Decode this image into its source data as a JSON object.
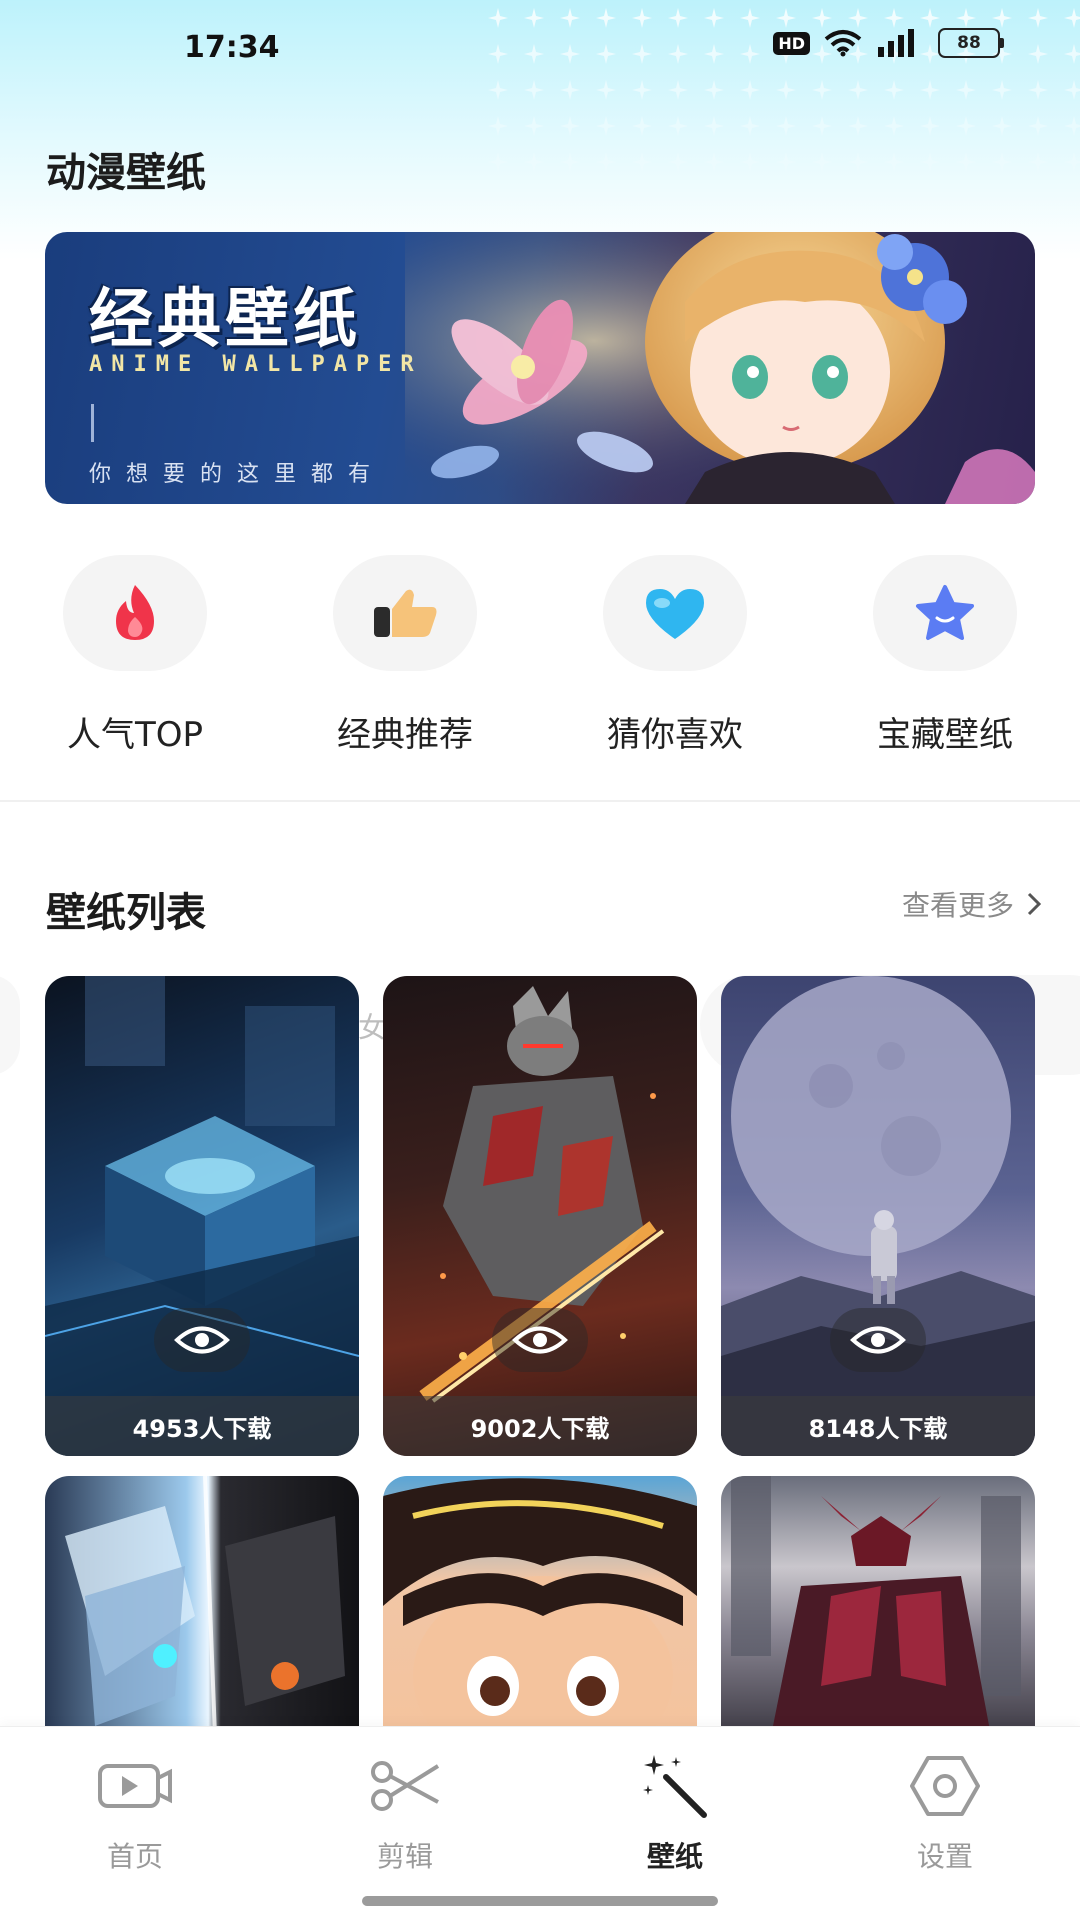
{
  "status_bar": {
    "time": "17:34",
    "hd": "HD",
    "battery": "88"
  },
  "page_title": "动漫壁纸",
  "banner": {
    "title": "经典壁纸",
    "subtitle": "ANIME WALLPAPER",
    "tagline": "你想要的这里都有"
  },
  "categories": [
    {
      "label": "人气TOP",
      "icon": "fire-icon",
      "color": "#f0344a"
    },
    {
      "label": "经典推荐",
      "icon": "thumbs-up-icon",
      "color": "#f6c37a"
    },
    {
      "label": "猜你喜欢",
      "icon": "heart-icon",
      "color": "#2fb6f0"
    },
    {
      "label": "宝藏壁纸",
      "icon": "star-icon",
      "color": "#5b7cf3"
    }
  ],
  "wallpaper_section": {
    "title": "壁纸列表",
    "more_label": "查看更多",
    "ghost_text": "女"
  },
  "wallpapers": [
    {
      "downloads": "4953人下载"
    },
    {
      "downloads": "9002人下载"
    },
    {
      "downloads": "8148人下载"
    }
  ],
  "tab_bar": {
    "tabs": [
      {
        "label": "首页",
        "icon": "video-icon"
      },
      {
        "label": "剪辑",
        "icon": "scissors-icon"
      },
      {
        "label": "壁纸",
        "icon": "magic-wand-icon"
      },
      {
        "label": "设置",
        "icon": "hexagon-settings-icon"
      }
    ],
    "active_index": 2
  }
}
